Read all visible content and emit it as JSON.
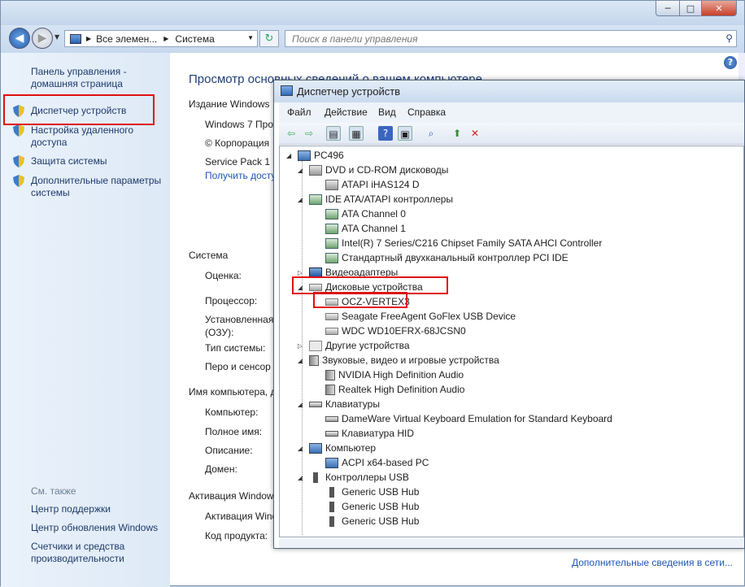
{
  "window": {
    "minimize": "─",
    "maximize": "□",
    "close": "✕"
  },
  "address": {
    "crumb1": "Все элемен...",
    "crumb2": "Система"
  },
  "search": {
    "placeholder": "Поиск в панели управления"
  },
  "sidebar": {
    "home": "Панель управления - домашняя страница",
    "links": [
      "Диспетчер устройств",
      "Настройка удаленного доступа",
      "Защита системы",
      "Дополнительные параметры системы"
    ],
    "see_also": "См. также",
    "see_also_links": [
      "Центр поддержки",
      "Центр обновления Windows",
      "Счетчики и средства производительности"
    ]
  },
  "main": {
    "title": "Просмотр основных сведений о вашем компьютере",
    "edition_header": "Издание Windows",
    "edition": [
      "Windows 7 Про",
      "© Корпорация",
      "Service Pack 1"
    ],
    "update_link": "Получить досту",
    "system_header": "Система",
    "system_rows": [
      "Оценка:",
      "Процессор:",
      "Установленная (ОЗУ):",
      "Тип системы:",
      "Перо и сенсор"
    ],
    "name_header": "Имя компьютера, д",
    "name_rows": [
      "Компьютер:",
      "Полное имя:",
      "Описание:",
      "Домен:"
    ],
    "activation_header": "Активация Window",
    "activation_rows": [
      "Активация Wind",
      "Код продукта:"
    ],
    "more_info": "Дополнительные сведения в сети..."
  },
  "devmgr": {
    "title": "Диспетчер устройств",
    "menu": [
      "Файл",
      "Действие",
      "Вид",
      "Справка"
    ],
    "root": "PC496",
    "tree": [
      {
        "label": "DVD и CD-ROM дисководы",
        "level": 1,
        "icon": "disc-drive-icon"
      },
      {
        "label": "ATAPI iHAS124   D",
        "level": 2,
        "icon": "disc-drive-icon"
      },
      {
        "label": "IDE ATA/ATAPI контроллеры",
        "level": 1,
        "icon": "controller-icon"
      },
      {
        "label": "ATA Channel 0",
        "level": 2,
        "icon": "controller-icon"
      },
      {
        "label": "ATA Channel 1",
        "level": 2,
        "icon": "controller-icon"
      },
      {
        "label": "Intel(R) 7 Series/C216 Chipset Family SATA AHCI Controller",
        "level": 2,
        "icon": "controller-icon"
      },
      {
        "label": "Стандартный двухканальный контроллер PCI IDE",
        "level": 2,
        "icon": "controller-icon"
      },
      {
        "label": "Видеоадаптеры",
        "level": 1,
        "icon": "monitor-icon"
      },
      {
        "label": "Дисковые устройства",
        "level": 1,
        "icon": "hard-disk-icon"
      },
      {
        "label": "OCZ-VERTEX3",
        "level": 2,
        "icon": "hard-disk-icon"
      },
      {
        "label": "Seagate FreeAgent GoFlex USB Device",
        "level": 2,
        "icon": "hard-disk-icon"
      },
      {
        "label": "WDC WD10EFRX-68JCSN0",
        "level": 2,
        "icon": "hard-disk-icon"
      },
      {
        "label": "Другие устройства",
        "level": 1,
        "icon": "unknown-device-icon"
      },
      {
        "label": "Звуковые, видео и игровые устройства",
        "level": 1,
        "icon": "speaker-icon"
      },
      {
        "label": "NVIDIA High Definition Audio",
        "level": 2,
        "icon": "speaker-icon"
      },
      {
        "label": "Realtek High Definition Audio",
        "level": 2,
        "icon": "speaker-icon"
      },
      {
        "label": "Клавиатуры",
        "level": 1,
        "icon": "keyboard-icon"
      },
      {
        "label": "DameWare Virtual Keyboard Emulation for Standard Keyboard",
        "level": 2,
        "icon": "keyboard-icon"
      },
      {
        "label": "Клавиатура HID",
        "level": 2,
        "icon": "keyboard-icon"
      },
      {
        "label": "Компьютер",
        "level": 1,
        "icon": "computer-icon"
      },
      {
        "label": "ACPI x64-based PC",
        "level": 2,
        "icon": "computer-icon"
      },
      {
        "label": "Контроллеры USB",
        "level": 1,
        "icon": "usb-icon"
      },
      {
        "label": "Generic USB Hub",
        "level": 2,
        "icon": "usb-icon"
      },
      {
        "label": "Generic USB Hub",
        "level": 2,
        "icon": "usb-icon"
      },
      {
        "label": "Generic USB Hub",
        "level": 2,
        "icon": "usb-icon"
      }
    ]
  },
  "colors": {
    "highlight": "#e01010",
    "link": "#1e56b8"
  }
}
